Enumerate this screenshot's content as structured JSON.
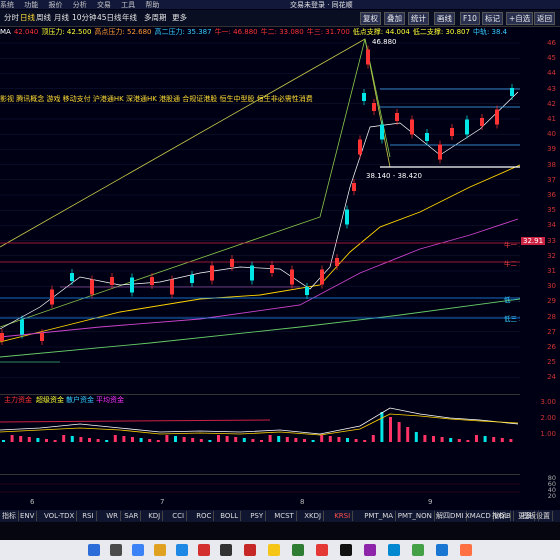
{
  "window_title": "交易未登录 · 同花顺",
  "menu": [
    "系统",
    "功能",
    "报价",
    "分析",
    "交易",
    "工具",
    "帮助"
  ],
  "periods": [
    "分时",
    "日线",
    "周线",
    "月线",
    "10分钟",
    "45日线",
    "年线",
    "多周期",
    "更多"
  ],
  "right_buttons": [
    "复权",
    "叠加",
    "统计",
    "画线",
    "F10",
    "标记",
    "+自选",
    "返回"
  ],
  "indicator_line": [
    {
      "text": "MA",
      "color": "#ffffff"
    },
    {
      "text": "42.040",
      "color": "#ff3333"
    },
    {
      "text": "顶压力: 42.500",
      "color": "#ffff33"
    },
    {
      "text": "高点压力: 52.680",
      "color": "#ff9933"
    },
    {
      "text": "高二压力: 35.387",
      "color": "#33ccff"
    },
    {
      "text": "牛一: 46.880",
      "color": "#ff3333"
    },
    {
      "text": "牛二: 33.080",
      "color": "#ff3333"
    },
    {
      "text": "牛三: 31.700",
      "color": "#ff3333"
    },
    {
      "text": "低点支撑: 44.004",
      "color": "#ffff33"
    },
    {
      "text": "低二支撑: 30.807",
      "color": "#ffff33"
    },
    {
      "text": "中轨: 38.4",
      "color": "#33ccff"
    }
  ],
  "concept_line": "影视 腾讯概念 游戏 移动支付 沪港通HK 深港通HK 港股通 合规证港股 恒生中型股 恒生非必需性消费",
  "annotations": {
    "peak_price": "46.880",
    "range_label": "38.140 - 38.420",
    "niu_yi": "牛一 3",
    "niu_er": "牛二 31",
    "di_yi": "低一 29",
    "di_san": "低三 26",
    "current_price": "32.91"
  },
  "price_ticks": [
    "46",
    "45",
    "44",
    "43",
    "42",
    "41",
    "40",
    "39",
    "38",
    "37",
    "36",
    "35",
    "34",
    "33",
    "32",
    "31",
    "30",
    "29",
    "28",
    "27",
    "26",
    "25",
    "24"
  ],
  "sub_indicator": {
    "labels": [
      {
        "text": "主力资金",
        "color": "#ff3333"
      },
      {
        "text": "超级资金",
        "color": "#ffff33"
      },
      {
        "text": "散户资金",
        "color": "#33ccff"
      },
      {
        "text": "平均资金",
        "color": "#ff33ff"
      }
    ],
    "ticks": [
      "3.00",
      "2.00",
      "1.00"
    ]
  },
  "volume_ticks": [
    "80",
    "60",
    "40",
    "20"
  ],
  "date_labels": [
    "6",
    "7",
    "8",
    "9"
  ],
  "tabs": [
    "指标",
    "ENV",
    "VOL-TDX",
    "RSI",
    "WR",
    "SAR",
    "KDJ",
    "CCI",
    "ROC",
    "BOLL",
    "PSY",
    "MCST",
    "XKDJ",
    "KRSI",
    "PMT_MA",
    "PMT_NON",
    "解四DMI",
    "XMACD",
    "VOL",
    "更多",
    "设置"
  ],
  "selected_tab": "KRSI",
  "tab_right": [
    "指标B",
    "模板"
  ],
  "colors": {
    "up": "#ff3333",
    "down": "#00ffff",
    "bg": "#000014",
    "grid": "#1f2448"
  }
}
